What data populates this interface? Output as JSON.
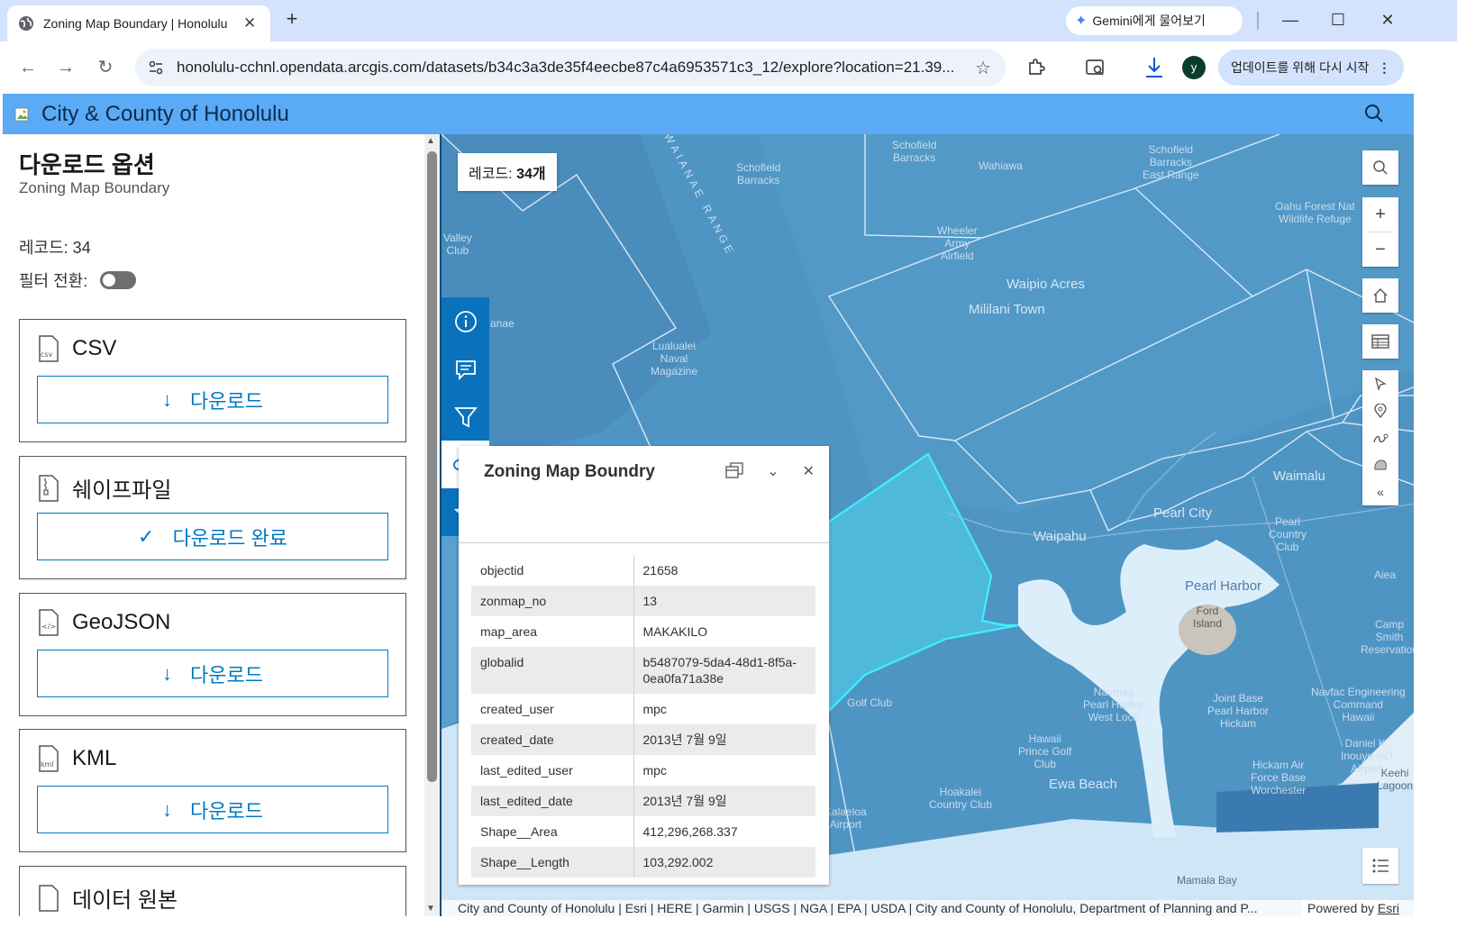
{
  "browser": {
    "tab_title": "Zoning Map Boundary | Honolulu",
    "gemini_label": "Gemini에게 물어보기",
    "url": "honolulu-cchnl.opendata.arcgis.com/datasets/b34c3a3de35f4eecbe87c4a6953571c3_12/explore?location=21.39...",
    "profile_initial": "y",
    "update_label": "업데이트를 위해 다시 시작"
  },
  "site": {
    "title": "City & County of Honolulu"
  },
  "panel": {
    "title": "다운로드 옵션",
    "subtitle": "Zoning Map Boundary",
    "records": "레코드: 34",
    "filter_label": "필터 전환:",
    "filter_on": false,
    "cards": [
      {
        "name": "CSV",
        "icon": "csv-file-icon",
        "button": "다운로드",
        "button_icon": "download-arrow-icon"
      },
      {
        "name": "쉐이프파일",
        "icon": "zip-file-icon",
        "button": "다운로드 완료",
        "button_icon": "check-icon"
      },
      {
        "name": "GeoJSON",
        "icon": "code-file-icon",
        "button": "다운로드",
        "button_icon": "download-arrow-icon"
      },
      {
        "name": "KML",
        "icon": "kml-file-icon",
        "button": "다운로드",
        "button_icon": "download-arrow-icon"
      },
      {
        "name": "데이터 원본",
        "icon": "file-icon"
      }
    ]
  },
  "map": {
    "record_badge_prefix": "레코드: ",
    "record_badge_count": "34개",
    "labels": {
      "schofield_barracks": "Schofield\nBarracks",
      "wahiawa": "Wahiawa",
      "schofield_barracks_2": "Schofield\nBarracks",
      "schofield_east": "Schofield\nBarracks\nEast Range",
      "oahu_forest": "Oahu Forest Nat\nWildlife Refuge",
      "valley_club": "Valley\nClub",
      "waianae_range": "WAIANAE RANGE",
      "wheeler": "Wheeler\nArmy\nAirfield",
      "waipio_acres": "Waipio Acres",
      "mililani": "Mililani Town",
      "anae": "anae",
      "lualualei": "Lualualei\nNaval\nMagazine",
      "waimalu": "Waimalu",
      "pearl_city": "Pearl City",
      "pearl_country": "Pearl\nCountry\nClub",
      "waipahu": "Waipahu",
      "pearl_harbor": "Pearl Harbor",
      "ford_island": "Ford\nIsland",
      "aiea": "Aiea",
      "camp_smith": "Camp\nSmith\nReservation",
      "navmag": "Navmag\nPearl Harbor\nWest Loch",
      "joint_base": "Joint Base\nPearl Harbor\nHickam",
      "navfac": "Navfac Engineering\nCommand\nHawaii",
      "daniel_k": "Daniel K.\nInouye Int'l\nAirport",
      "hawaii_prince": "Hawaii\nPrince Golf\nClub",
      "hickam": "Hickam Air\nForce Base\nWorchester",
      "ewa_beach": "Ewa Beach",
      "hoakalei": "Hoakalei\nCountry Club",
      "kalaeloa": "Kalaeloa\nAirport",
      "golf_club": "Golf Club",
      "mamala_bay": "Mamala Bay",
      "keehi": "Keehi\nLagoon"
    },
    "popup": {
      "title": "Zoning Map Boundry",
      "rows": [
        {
          "k": "objectid",
          "v": "21658"
        },
        {
          "k": "zonmap_no",
          "v": "13"
        },
        {
          "k": "map_area",
          "v": "MAKAKILO"
        },
        {
          "k": "globalid",
          "v": "b5487079-5da4-48d1-8f5a-0ea0fa71a38e"
        },
        {
          "k": "created_user",
          "v": "mpc"
        },
        {
          "k": "created_date",
          "v": "2013년 7월 9일"
        },
        {
          "k": "last_edited_user",
          "v": "mpc"
        },
        {
          "k": "last_edited_date",
          "v": "2013년 7월 9일"
        },
        {
          "k": "Shape__Area",
          "v": "412,296,268.337"
        },
        {
          "k": "Shape__Length",
          "v": "103,292.002"
        }
      ]
    },
    "attribution": "City and County of Honolulu | Esri | HERE | Garmin | USGS | NGA | EPA | USDA | City and County of Honolulu, Department of Planning and P...",
    "powered_prefix": "Powered by ",
    "powered_link": "Esri"
  }
}
